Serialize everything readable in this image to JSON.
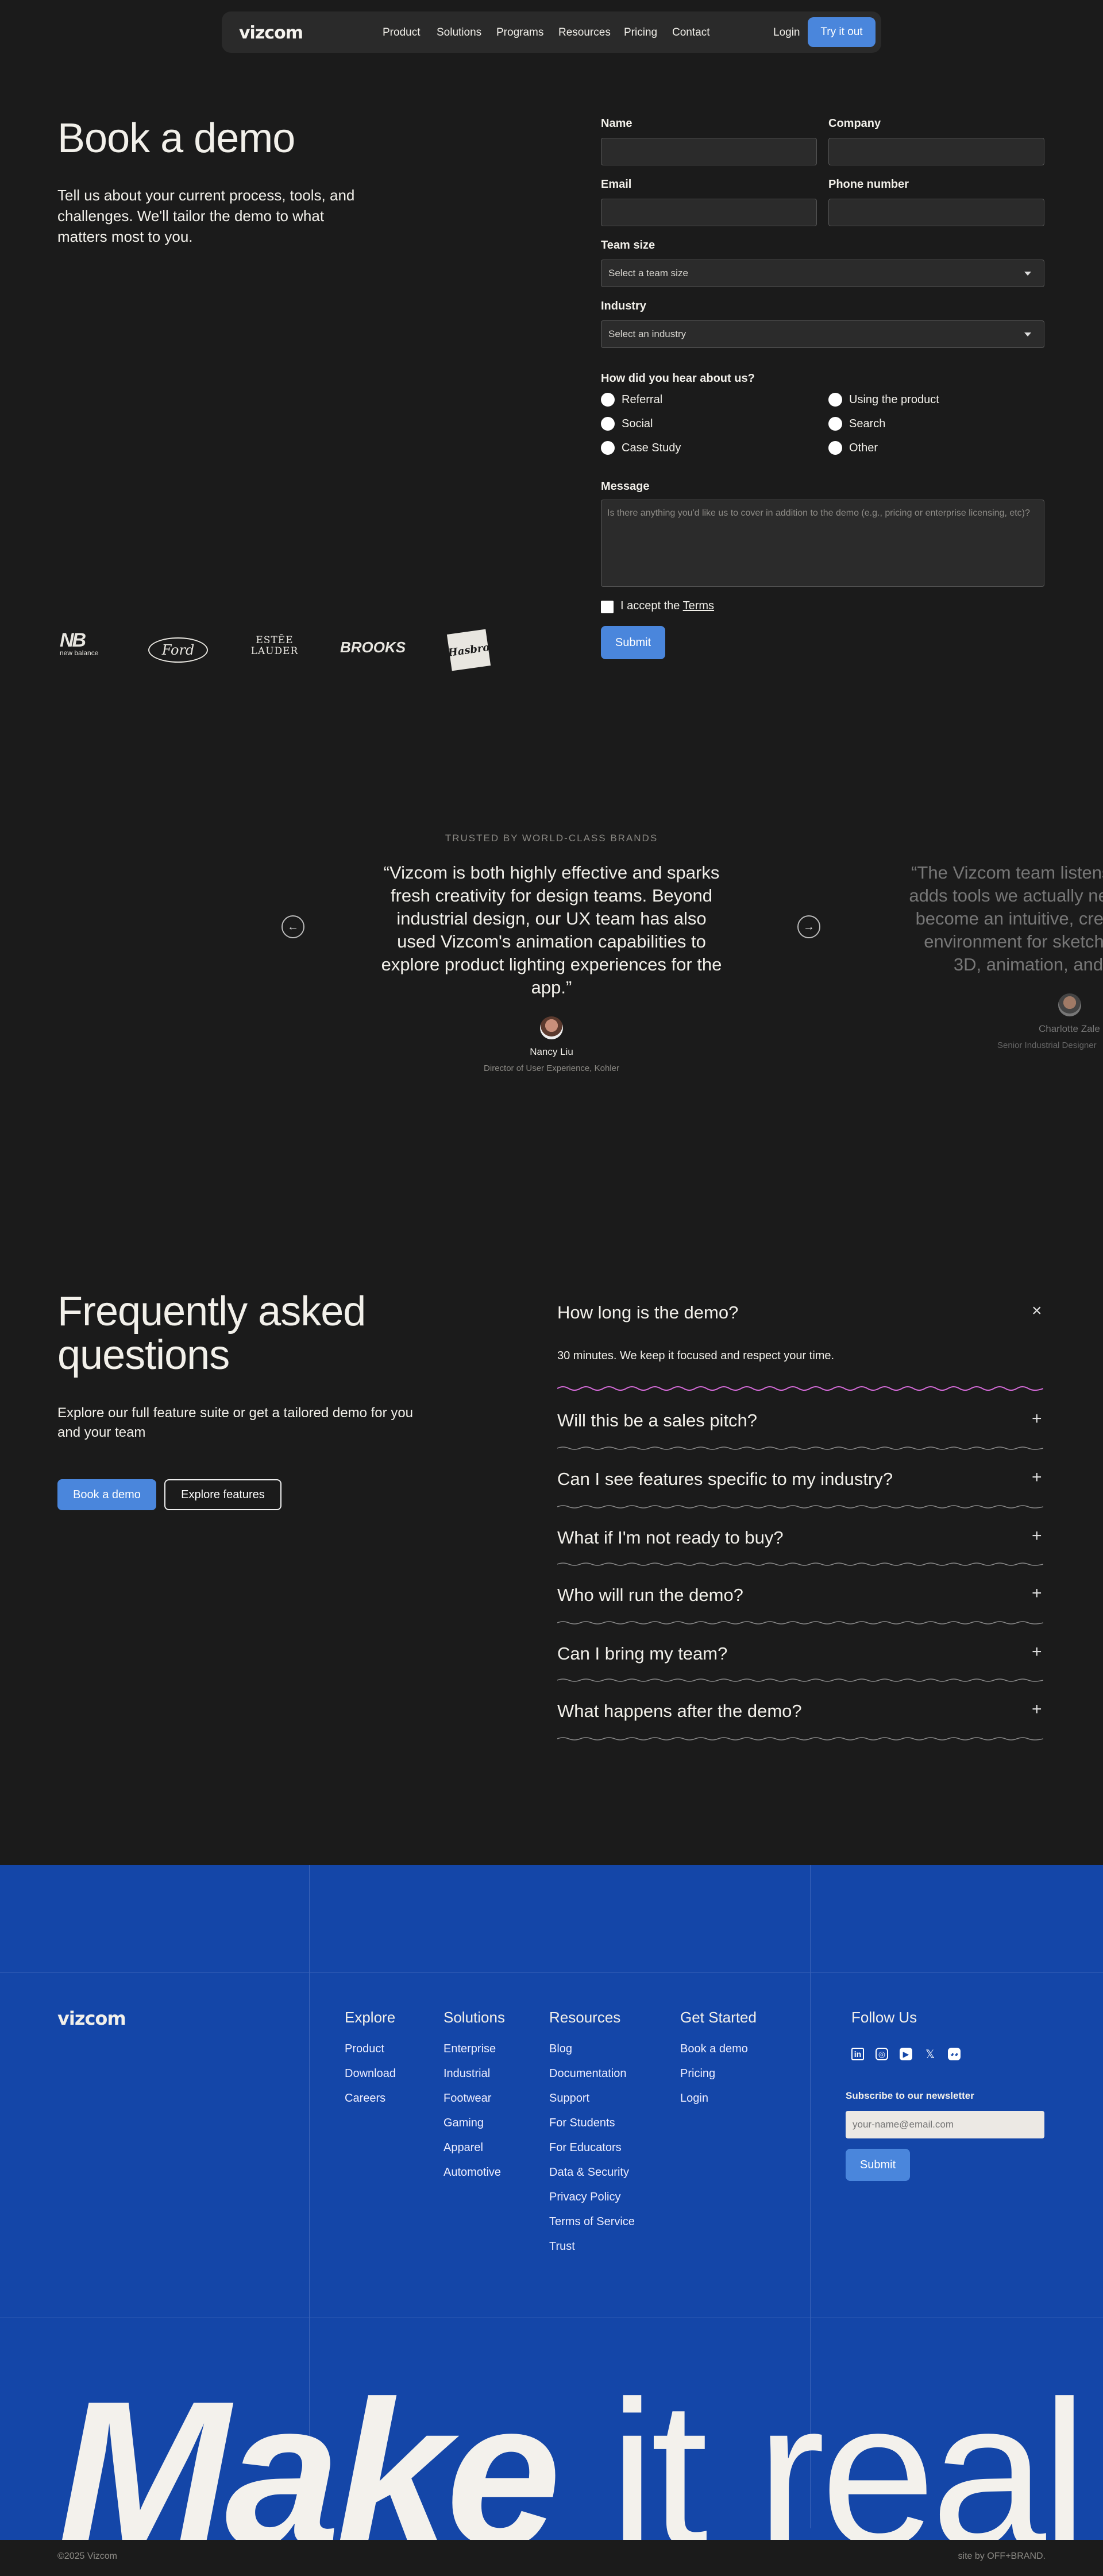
{
  "nav": {
    "logo": "vizcom",
    "links": [
      "Product",
      "Solutions",
      "Programs",
      "Resources",
      "Pricing",
      "Contact"
    ],
    "login": "Login",
    "cta": "Try it out"
  },
  "hero": {
    "title": "Book a demo",
    "lead": "Tell us about your current process, tools, and challenges. We'll tailor the demo to what matters most to you."
  },
  "form": {
    "name_label": "Name",
    "company_label": "Company",
    "email_label": "Email",
    "phone_label": "Phone number",
    "team_label": "Team size",
    "team_placeholder": "Select a team size",
    "industry_label": "Industry",
    "industry_placeholder": "Select an industry",
    "hear_label": "How did you hear about us?",
    "hear_options": [
      "Referral",
      "Using the product",
      "Social",
      "Search",
      "Case Study",
      "Other"
    ],
    "message_label": "Message",
    "message_placeholder": "Is there anything you'd like us to cover in addition to the demo (e.g., pricing or enterprise licensing, etc)?",
    "accept_text": "I accept the ",
    "terms_link": "Terms",
    "submit": "Submit"
  },
  "brands": [
    "new balance",
    "Ford",
    "ESTĒE LAUDER",
    "BROOKS",
    "Hasbro"
  ],
  "testimonials": {
    "eyebrow": "TRUSTED BY WORLD-CLASS BRANDS",
    "prev_icon": "arrow-left-icon",
    "next_icon": "arrow-right-icon",
    "items": [
      {
        "quote": "“Vizcom is both highly effective and sparks fresh creativity for design teams. Beyond industrial design, our UX team has also used Vizcom's animation capabilities to explore product lighting experiences for the app.”",
        "name": "Nancy Liu",
        "role": "Director of User Experience, Kohler"
      },
      {
        "quote": "“The Vizcom team listens and adds tools we actually need to become an intuitive, creative environment for sketching, 3D, animation, and",
        "name": "Charlotte Zale",
        "role": "Senior Industrial Designer"
      }
    ]
  },
  "faq": {
    "title": "Frequently asked questions",
    "subtitle": "Explore our full feature suite or get a tailored demo for you and your team",
    "book_demo": "Book a demo",
    "explore": "Explore features",
    "items": [
      {
        "q": "How long is the demo?",
        "a": "30 minutes. We keep it focused and respect your time.",
        "open": true
      },
      {
        "q": "Will this be a sales pitch?"
      },
      {
        "q": "Can I see features specific to my industry?"
      },
      {
        "q": "What if I'm not ready to buy?"
      },
      {
        "q": "Who will run the demo?"
      },
      {
        "q": "Can I bring my team?"
      },
      {
        "q": "What happens after the demo?"
      }
    ],
    "open_icon": "×",
    "closed_icon": "+"
  },
  "footer": {
    "logo": "vizcom",
    "columns": [
      {
        "title": "Explore",
        "links": [
          "Product",
          "Download",
          "Careers"
        ]
      },
      {
        "title": "Solutions",
        "links": [
          "Enterprise",
          "Industrial",
          "Footwear",
          "Gaming",
          "Apparel",
          "Automotive"
        ]
      },
      {
        "title": "Resources",
        "links": [
          "Blog",
          "Documentation",
          "Support",
          "For Students",
          "For Educators",
          "Data & Security",
          "Privacy Policy",
          "Terms of Service",
          "Trust"
        ]
      },
      {
        "title": "Get Started",
        "links": [
          "Book a demo",
          "Pricing",
          "Login"
        ]
      }
    ],
    "follow": "Follow Us",
    "socials": [
      "linkedin-icon",
      "instagram-icon",
      "youtube-icon",
      "x-icon",
      "discord-icon"
    ],
    "newsletter_label": "Subscribe to our newsletter",
    "email_placeholder": "your-name@email.com",
    "submit": "Submit",
    "tagline_a": "Make",
    "tagline_b": " it real",
    "copyright": "©2025 Vizcom",
    "credit": "site by OFF+BRAND."
  },
  "colors": {
    "accent": "#4a86dc",
    "footer_bg": "#1446a8",
    "page_bg": "#1b1b1b",
    "wave_active": "#d46bd8"
  }
}
